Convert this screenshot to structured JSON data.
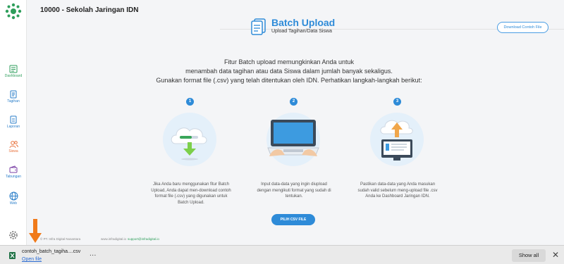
{
  "header": {
    "title": "10000 - Sekolah Jaringan IDN"
  },
  "sidebar": {
    "items": [
      {
        "label": "Dashboard",
        "icon": "dashboard-icon"
      },
      {
        "label": "Tagihan",
        "icon": "invoice-icon"
      },
      {
        "label": "Laporan",
        "icon": "report-icon"
      },
      {
        "label": "Siswa",
        "icon": "users-icon"
      },
      {
        "label": "Tabungan",
        "icon": "wallet-icon"
      },
      {
        "label": "Web",
        "icon": "globe-icon"
      }
    ]
  },
  "page": {
    "title": "Batch Upload",
    "subtitle": "Upload Tagihan/Data Siswa",
    "download_button": "Download Contoh File",
    "intro": [
      "Fitur Batch upload memungkinkan Anda untuk",
      "menambah data tagihan atau data Siswa dalam jumlah banyak sekaligus.",
      "Gunakan format file (.csv) yang telah ditentukan oleh IDN. Perhatikan langkah-langkah berikut:"
    ],
    "steps": [
      {
        "number": "1",
        "lines": [
          "Jika Anda baru menggunakan fitur Batch",
          "Upload, Anda dapat men-download contoh",
          "format file (.csv) yang digunakan untuk",
          "Batch Upload."
        ]
      },
      {
        "number": "2",
        "lines": [
          "Input data-data yang ingin diupload",
          "dengan mengikuti format yang sudah di",
          "tentukan."
        ]
      },
      {
        "number": "3",
        "lines": [
          "Pastikan data-data yang Anda masukan",
          "sudah valid sebelum meng-upload file .csv",
          "Anda ke Dashboard Jaringan IDN."
        ]
      }
    ],
    "upload_button": "PILIH CSV FILE"
  },
  "footer": {
    "company": "© PT. Infra Digital Nusantara",
    "website": "www.infradigital.io",
    "email": "support@infradigital.io"
  },
  "download_bar": {
    "filename": "contoh_batch_tagiha....csv",
    "open_link": "Open file",
    "more": "...",
    "show_all": "Show all",
    "close": "✕"
  },
  "colors": {
    "accent": "#2e8bd8",
    "brand_green": "#2e9e5b",
    "arrow": "#f07a1a"
  }
}
